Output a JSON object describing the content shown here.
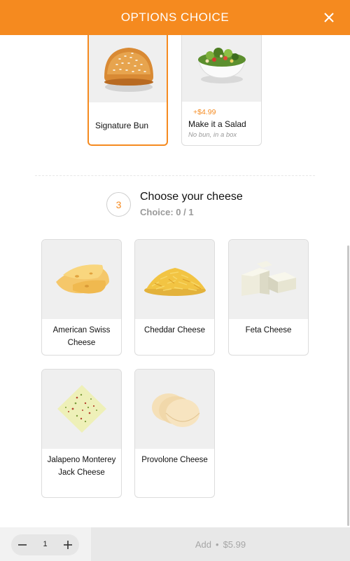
{
  "header": {
    "title": "OPTIONS CHOICE"
  },
  "previous_options": [
    {
      "name": "Signature Bun",
      "price": "",
      "sub": "",
      "selected": true
    },
    {
      "name": "Make it a Salad",
      "price": "+$4.99",
      "sub": "No bun, in a box",
      "selected": false
    }
  ],
  "section": {
    "step": "3",
    "title": "Choose your cheese",
    "choice": "Choice: 0 / 1"
  },
  "cheeses": [
    {
      "name": "American Swiss Cheese"
    },
    {
      "name": "Cheddar Cheese"
    },
    {
      "name": "Feta Cheese"
    },
    {
      "name": "Jalapeno Monterey Jack Cheese"
    },
    {
      "name": "Provolone Cheese"
    }
  ],
  "footer": {
    "quantity": "1",
    "add_label": "Add",
    "separator": "•",
    "price": "$5.99"
  },
  "colors": {
    "accent": "#f58a1f",
    "card_border": "#dcdcdc",
    "image_bg": "#efefef"
  }
}
